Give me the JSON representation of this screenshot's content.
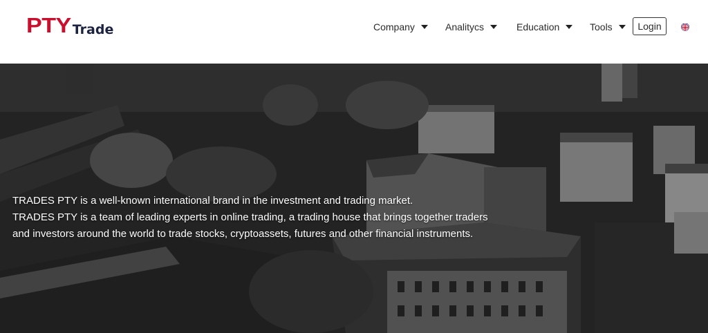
{
  "brand": {
    "mark": "PTY",
    "name": "Trade",
    "mark_color": "#c8102e",
    "name_color": "#1c2340"
  },
  "nav": {
    "items": [
      {
        "label": "Company"
      },
      {
        "label": "Analitycs"
      },
      {
        "label": "Education"
      },
      {
        "label": "Tools"
      }
    ],
    "login_label": "Login",
    "language_icon": "uk-flag-icon"
  },
  "hero": {
    "lines": [
      "TRADES PTY is a well-known international brand in the investment and trading market.",
      "TRADES PTY is a team of leading experts in online trading, a trading house that brings together traders",
      "and investors around the world to trade stocks, cryptoassets, futures and other financial instruments."
    ]
  }
}
